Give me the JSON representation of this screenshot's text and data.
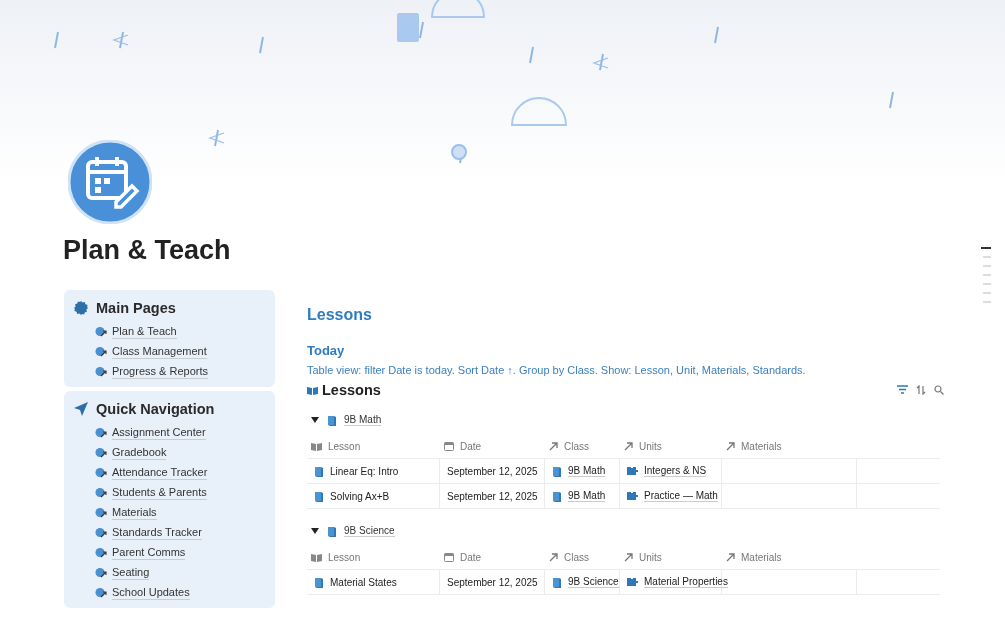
{
  "page": {
    "title": "Plan & Teach"
  },
  "sidebar": [
    {
      "heading": "Main Pages",
      "kind": "pages",
      "items": [
        "Plan & Teach",
        "Class Management",
        "Progress & Reports"
      ]
    },
    {
      "heading": "Quick Navigation",
      "kind": "navigation",
      "items": [
        "Assignment Center",
        "Gradebook",
        "Attendance Tracker",
        "Students & Parents",
        "Materials",
        "Standards Tracker",
        "Parent Comms",
        "Seating",
        "School Updates"
      ]
    }
  ],
  "section_title": "Lessons",
  "subsection_title": "Today",
  "description": "Table view: filter Date is today. Sort Date ↑. Group by Class. Show: Lesson, Unit, Materials, Standards.",
  "database": {
    "title": "Lessons",
    "groups": [
      {
        "name": "9B Math",
        "expanded": true,
        "columns": [
          "Lesson",
          "Date",
          "Class",
          "Units",
          "Materials"
        ],
        "rows": [
          {
            "lesson": "Linear Eq: Intro",
            "date": "September 12, 2025",
            "class": "9B Math",
            "unit": "Integers & NS"
          },
          {
            "lesson": "Solving Ax+B",
            "date": "September 12, 2025",
            "class": "9B Math",
            "unit": "Practice — Math"
          }
        ]
      },
      {
        "name": "9B Science",
        "expanded": true,
        "columns": [
          "Lesson",
          "Date",
          "Class",
          "Units",
          "Materials"
        ],
        "rows": [
          {
            "lesson": "Material States",
            "date": "September 12, 2025",
            "class": "9B Science",
            "unit": "Material Properties"
          }
        ]
      }
    ]
  },
  "outline_markers": [
    {
      "selected": true
    },
    {
      "selected": false
    },
    {
      "selected": false
    },
    {
      "selected": false
    },
    {
      "selected": false
    },
    {
      "selected": false
    },
    {
      "selected": false
    }
  ]
}
